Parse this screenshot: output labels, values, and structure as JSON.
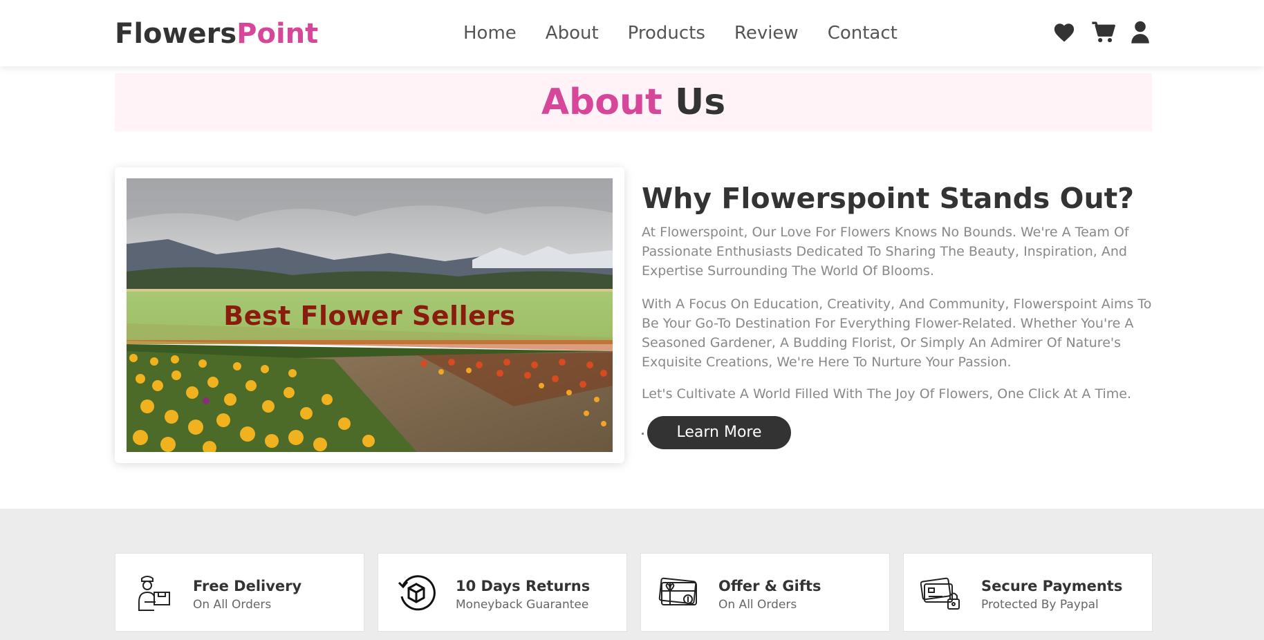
{
  "header": {
    "logo_main": "Flowers",
    "logo_accent": "Point",
    "nav": [
      "Home",
      "About",
      "Products",
      "Review",
      "Contact"
    ],
    "icons": [
      "heart-icon",
      "cart-icon",
      "user-icon"
    ]
  },
  "title": {
    "accent": "About",
    "main": " Us"
  },
  "image": {
    "banner_text": "Best Flower Sellers"
  },
  "about": {
    "heading": "Why Flowerspoint Stands Out?",
    "p1": "At Flowerspoint, Our Love For Flowers Knows No Bounds. We're A Team Of Passionate Enthusiasts Dedicated To Sharing The Beauty, Inspiration, And Expertise Surrounding The World Of Blooms.",
    "p2": "With A Focus On Education, Creativity, And Community, Flowerspoint Aims To Be Your Go-To Destination For Everything Flower-Related. Whether You're A Seasoned Gardener, A Budding Florist, Or Simply An Admirer Of Nature's Exquisite Creations, We're Here To Nurture Your Passion.",
    "p3": "Let's Cultivate A World Filled With The Joy Of Flowers, One Click At A Time.",
    "button": "Learn More"
  },
  "features": [
    {
      "title": "Free Delivery",
      "sub": "On All Orders",
      "icon": "delivery-person-icon"
    },
    {
      "title": "10 Days Returns",
      "sub": "Moneyback Guarantee",
      "icon": "return-box-icon"
    },
    {
      "title": "Offer & Gifts",
      "sub": "On All Orders",
      "icon": "gift-card-icon"
    },
    {
      "title": "Secure Payments",
      "sub": "Protected By Paypal",
      "icon": "secure-card-icon"
    }
  ],
  "colors": {
    "accent": "#d6479a",
    "dark": "#333333",
    "title_band": "#fff3f8",
    "features_bg": "#ececec"
  }
}
